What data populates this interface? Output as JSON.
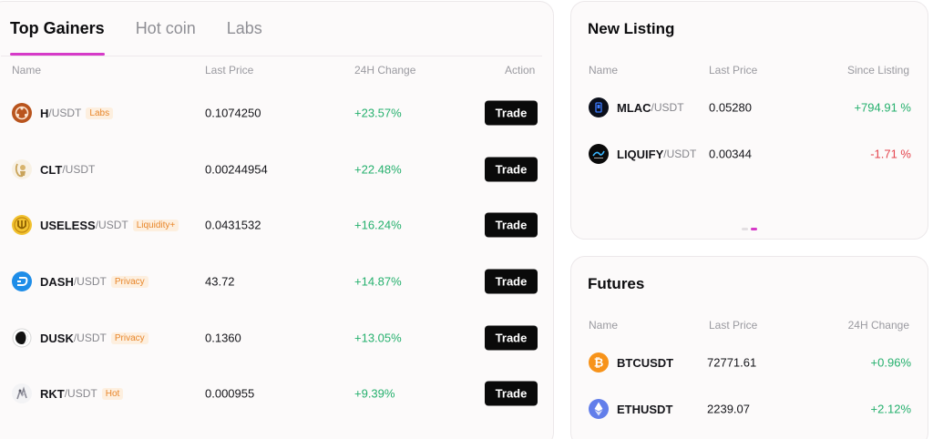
{
  "top_gainers": {
    "tabs": [
      {
        "label": "Top Gainers",
        "active": true
      },
      {
        "label": "Hot coin",
        "active": false
      },
      {
        "label": "Labs",
        "active": false
      }
    ],
    "columns": {
      "name": "Name",
      "last_price": "Last Price",
      "change": "24H Change",
      "action": "Action"
    },
    "rows": [
      {
        "symbol": "H",
        "quote": "/USDT",
        "tag": "Labs",
        "price": "0.1074250",
        "change": "+23.57%",
        "action": "Trade",
        "icon": "h-coin-icon"
      },
      {
        "symbol": "CLT",
        "quote": "/USDT",
        "tag": "",
        "price": "0.00244954",
        "change": "+22.48%",
        "action": "Trade",
        "icon": "clt-coin-icon"
      },
      {
        "symbol": "USELESS",
        "quote": "/USDT",
        "tag": "Liquidity+",
        "price": "0.0431532",
        "change": "+16.24%",
        "action": "Trade",
        "icon": "useless-coin-icon"
      },
      {
        "symbol": "DASH",
        "quote": "/USDT",
        "tag": "Privacy",
        "price": "43.72",
        "change": "+14.87%",
        "action": "Trade",
        "icon": "dash-coin-icon"
      },
      {
        "symbol": "DUSK",
        "quote": "/USDT",
        "tag": "Privacy",
        "price": "0.1360",
        "change": "+13.05%",
        "action": "Trade",
        "icon": "dusk-coin-icon"
      },
      {
        "symbol": "RKT",
        "quote": "/USDT",
        "tag": "Hot",
        "price": "0.000955",
        "change": "+9.39%",
        "action": "Trade",
        "icon": "rkt-coin-icon"
      }
    ]
  },
  "new_listing": {
    "title": "New Listing",
    "columns": {
      "name": "Name",
      "last_price": "Last Price",
      "change": "Since Listing"
    },
    "rows": [
      {
        "symbol": "MLAC",
        "quote": "/USDT",
        "price": "0.05280",
        "change": "+794.91 %",
        "direction": "up",
        "icon": "mlac-coin-icon"
      },
      {
        "symbol": "LIQUIFY",
        "quote": "/USDT",
        "price": "0.00344",
        "change": "-1.71 %",
        "direction": "down",
        "icon": "liquify-coin-icon"
      }
    ],
    "carousel_pages": 2,
    "carousel_active": 2
  },
  "futures": {
    "title": "Futures",
    "columns": {
      "name": "Name",
      "last_price": "Last Price",
      "change": "24H Change"
    },
    "rows": [
      {
        "symbol": "BTCUSDT",
        "price": "72771.61",
        "change": "+0.96%",
        "icon": "bitcoin-icon"
      },
      {
        "symbol": "ETHUSDT",
        "price": "2239.07",
        "change": "+2.12%",
        "icon": "ethereum-icon"
      }
    ]
  },
  "colors": {
    "accent": "#d63ac8",
    "up": "#25b06d",
    "down": "#e4444d",
    "tag_text": "#e8862a",
    "tag_bg": "#fdefdf"
  }
}
